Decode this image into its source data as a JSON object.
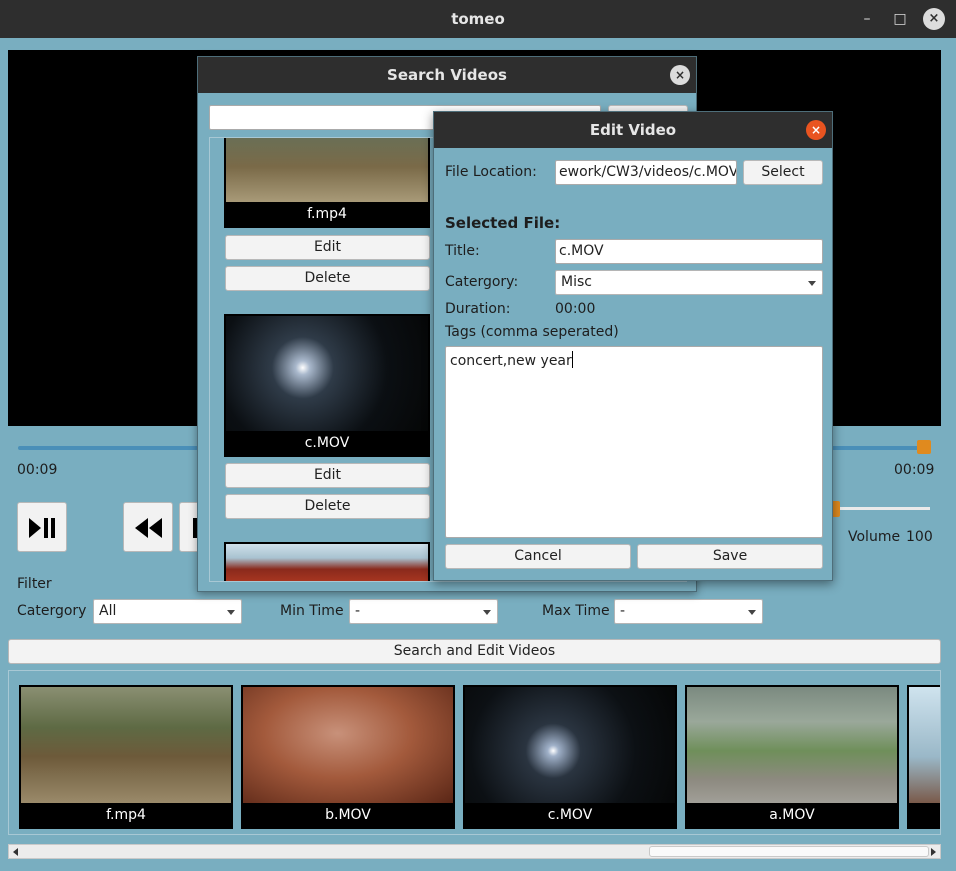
{
  "window": {
    "title": "tomeo",
    "minimize_glyph": "–",
    "maximize_glyph": "□",
    "close_glyph": "×"
  },
  "player": {
    "time_elapsed": "00:09",
    "time_total": "00:09",
    "progress_fraction": 1.0,
    "volume_label": "Volume",
    "volume_value": "100",
    "volume_fraction": 0.05,
    "icons": [
      "play-pause-icon",
      "rewind-icon",
      "stop-icon"
    ]
  },
  "filter": {
    "heading": "Filter",
    "category_label": "Catergory",
    "category_value": "All",
    "min_time_label": "Min Time",
    "min_time_value": "-",
    "max_time_label": "Max Time",
    "max_time_value": "-"
  },
  "search_edit_button": "Search and Edit Videos",
  "thumbnails": [
    {
      "name": "f.mp4",
      "scene": "zoo"
    },
    {
      "name": "b.MOV",
      "scene": "hand"
    },
    {
      "name": "c.MOV",
      "scene": "night"
    },
    {
      "name": "a.MOV",
      "scene": "mountain"
    }
  ],
  "search_dialog": {
    "title": "Search Videos",
    "close_glyph": "×",
    "search_value": "",
    "results": [
      {
        "name": "f.mp4",
        "edit_label": "Edit",
        "delete_label": "Delete"
      },
      {
        "name": "c.MOV",
        "edit_label": "Edit",
        "delete_label": "Delete"
      }
    ]
  },
  "edit_dialog": {
    "title": "Edit Video",
    "close_glyph": "×",
    "file_location_label": "File Location:",
    "file_location_value": "ework/CW3/videos/c.MOV",
    "select_label": "Select",
    "selected_file_heading": "Selected File:",
    "title_label": "Title:",
    "title_value": "c.MOV",
    "category_label": "Catergory:",
    "category_value": "Misc",
    "duration_label": "Duration:",
    "duration_value": "00:00",
    "tags_label": "Tags (comma seperated)",
    "tags_value": "concert,new year",
    "cancel_label": "Cancel",
    "save_label": "Save"
  },
  "colors": {
    "background": "#79aec0",
    "titlebar": "#2e2e2e",
    "accent_orange": "#e08a1e",
    "close_orange": "#e95420"
  }
}
